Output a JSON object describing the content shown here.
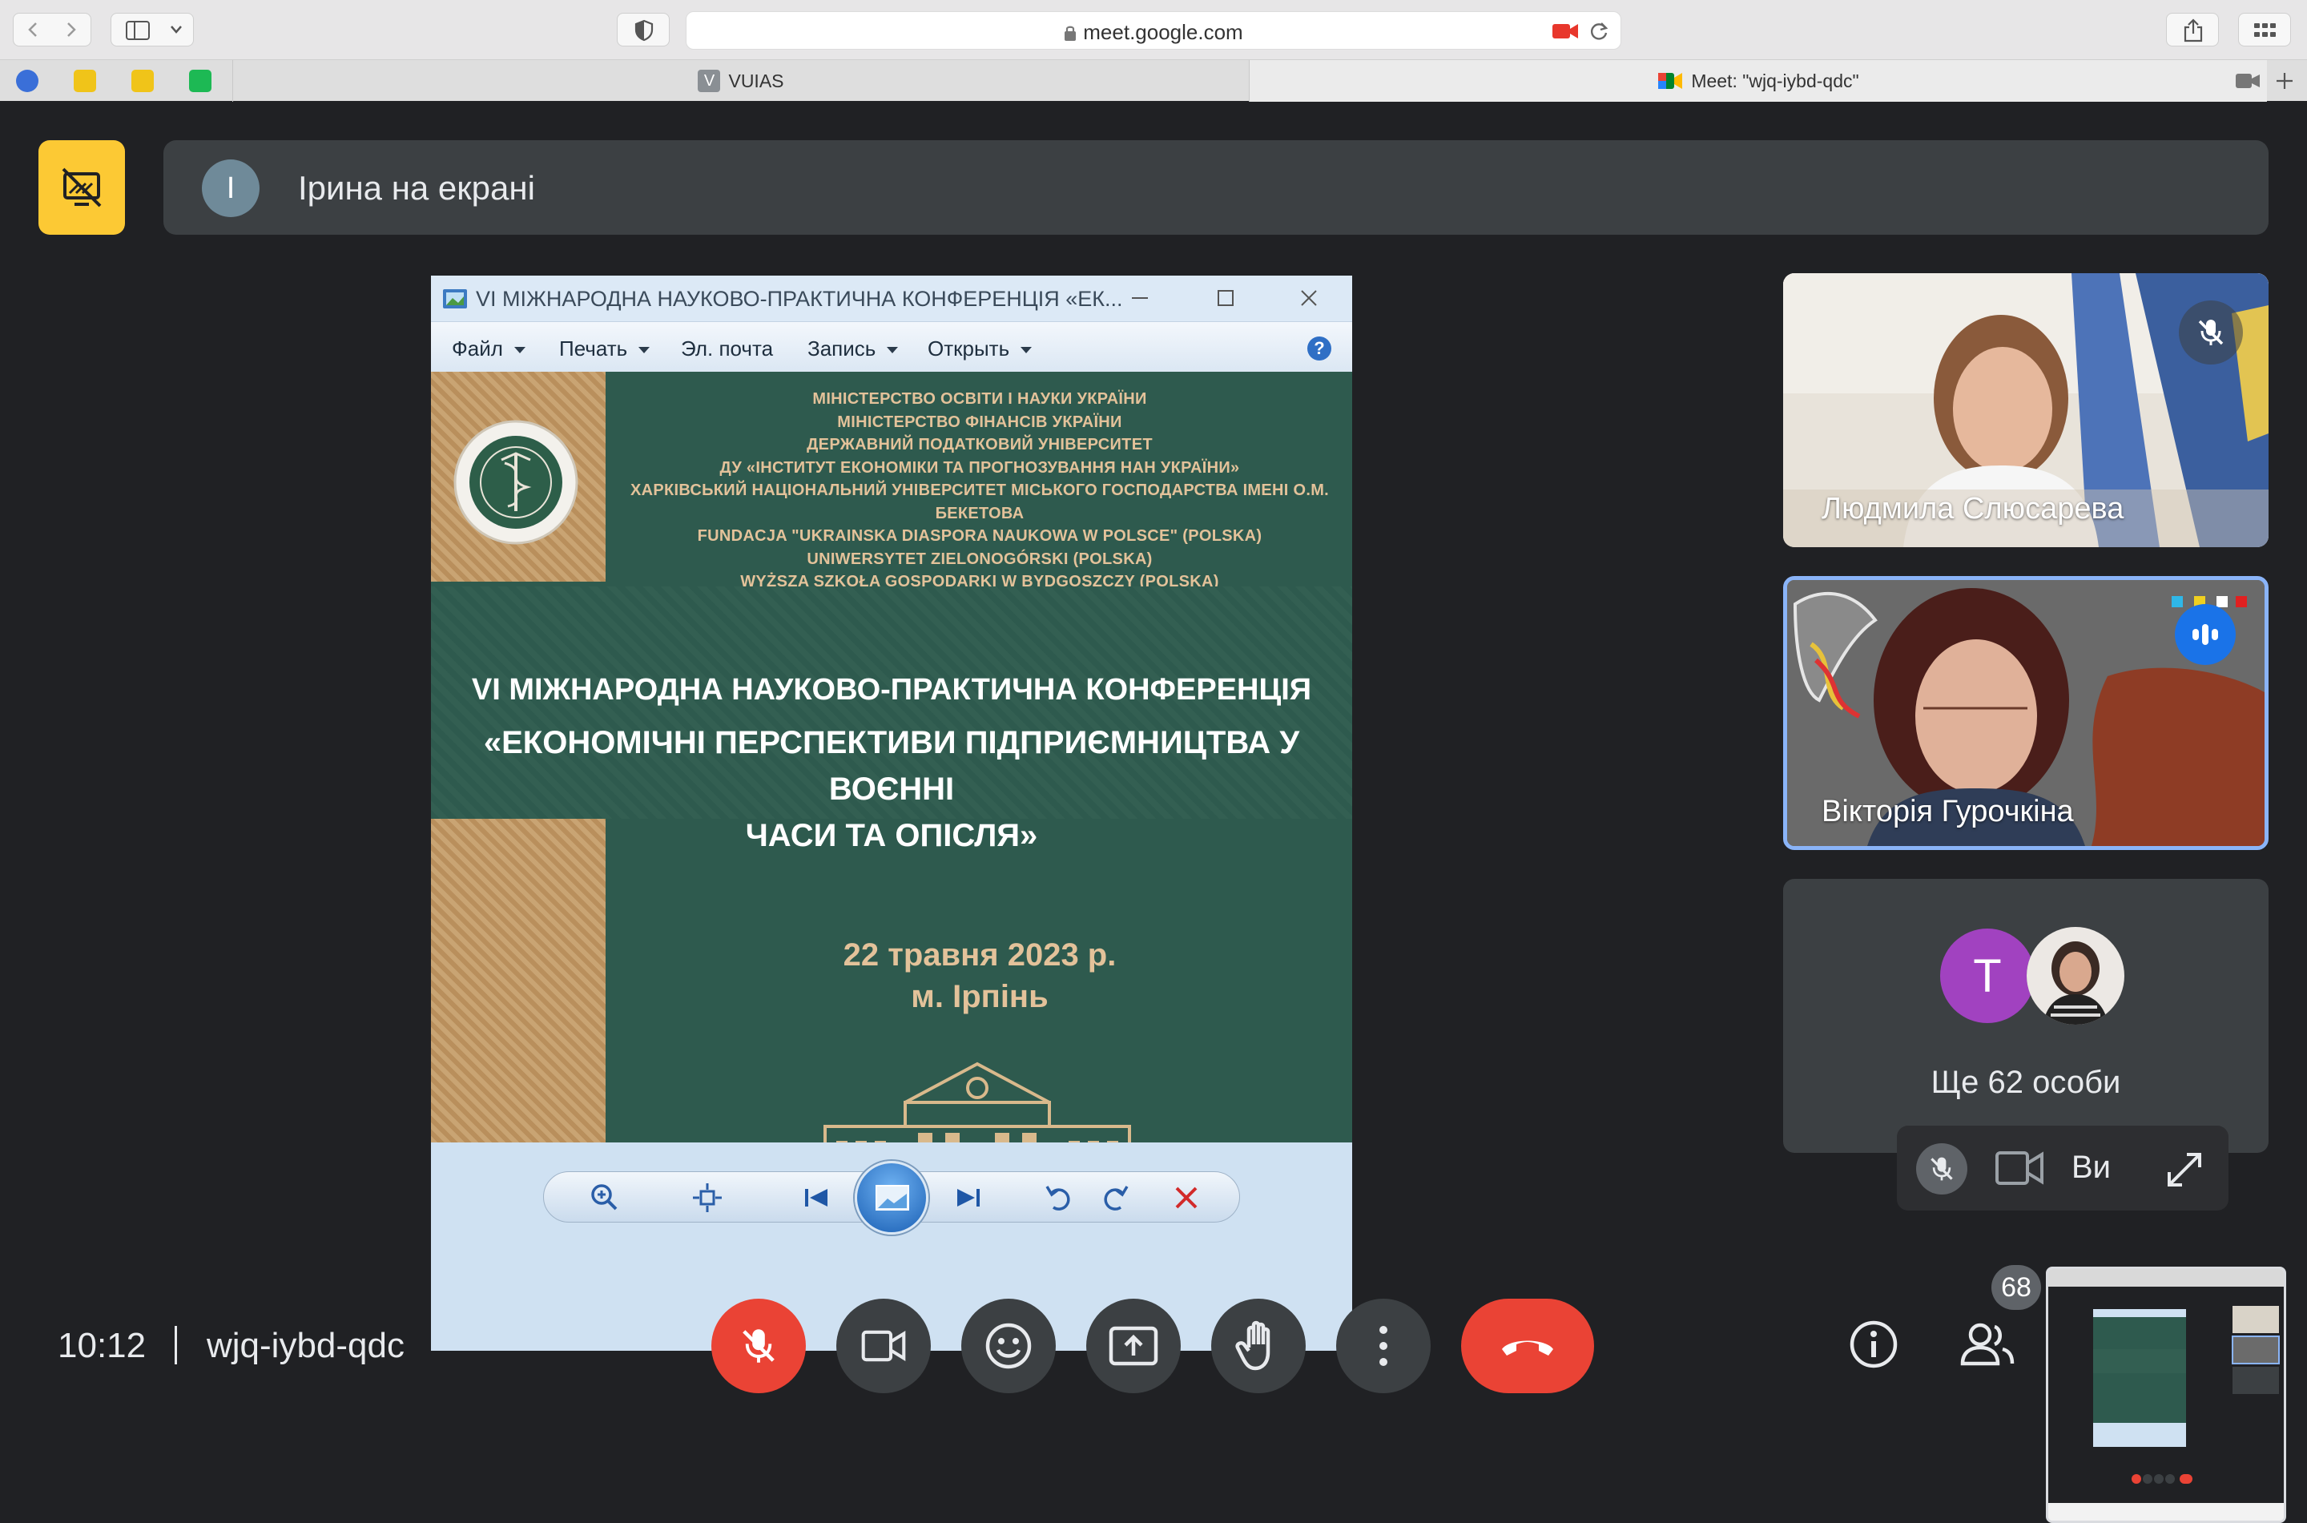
{
  "browser": {
    "url": "meet.google.com",
    "tabs": [
      {
        "label": "VUIAS",
        "badge": "V"
      },
      {
        "label": "Meet: \"wjq-iybd-qdc\""
      }
    ]
  },
  "meet": {
    "presenter_avatar": "І",
    "presenter_text": "Ірина на екрані",
    "time": "10:12",
    "meeting_code": "wjq-iybd-qdc",
    "participants_count": "68",
    "self_label": "Ви",
    "others_avatar": "T",
    "others_text": "Ще 62 особи",
    "tiles": [
      {
        "name": "Людмила Слюсарева",
        "muted": true
      },
      {
        "name": "Вікторія Гурочкіна",
        "speaking": true
      }
    ]
  },
  "shared_window": {
    "title": "VI МІЖНАРОДНА НАУКОВО-ПРАКТИЧНА КОНФЕРЕНЦІЯ «ЕК...",
    "menu": {
      "file": "Файл",
      "print": "Печать",
      "email": "Эл. почта",
      "record": "Запись",
      "open": "Открыть"
    },
    "poster": {
      "orgs": [
        "МІНІСТЕРСТВО ОСВІТИ І НАУКИ УКРАЇНИ",
        "МІНІСТЕРСТВО ФІНАНСІВ УКРАЇНИ",
        "ДЕРЖАВНИЙ ПОДАТКОВИЙ УНІВЕРСИТЕТ",
        "ДУ «ІНСТИТУТ ЕКОНОМІКИ ТА ПРОГНОЗУВАННЯ НАН УКРАЇНИ»",
        "ХАРКІВСЬКИЙ НАЦІОНАЛЬНИЙ УНІВЕРСИТЕТ МІСЬКОГО ГОСПОДАРСТВА ІМЕНІ О.М. БЕКЕТОВА",
        "FUNDACJA \"UKRAINSKA DIASPORA NAUKOWA W POLSCE\" (POLSKA)",
        "UNIWERSYTET ZIELONOGÓRSKI (POLSKA)",
        "WYŻSZA SZKOŁA GOSPODARKI W BYDGOSZCZY (POLSKA)"
      ],
      "conference_line1": "VI МІЖНАРОДНА НАУКОВО-ПРАКТИЧНА КОНФЕРЕНЦІЯ",
      "conference_line2": "«ЕКОНОМІЧНІ ПЕРСПЕКТИВИ ПІДПРИЄМНИЦТВА У ВОЄННІ",
      "conference_line3": "ЧАСИ ТА ОПІСЛЯ»",
      "date": "22 травня 2023 р.",
      "city": "м. Ірпінь"
    }
  },
  "colors": {
    "meet_bg": "#202124",
    "end_call": "#ea4335",
    "present_icon": "#fcc934",
    "poster_green": "#2e5a4e",
    "poster_gold": "#e3c29a"
  }
}
